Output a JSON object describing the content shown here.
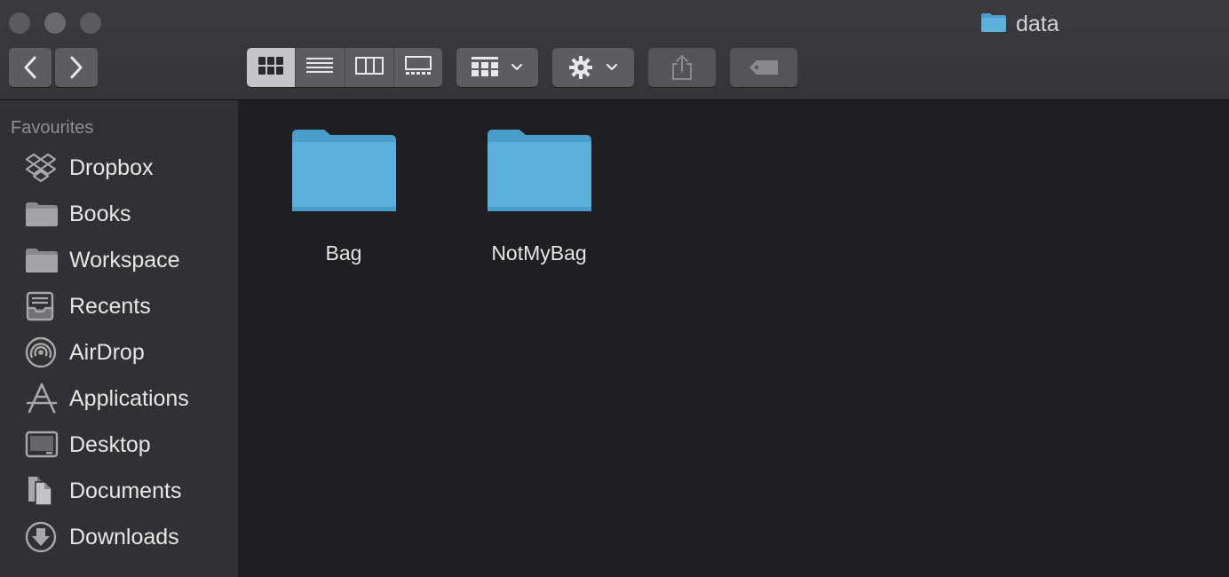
{
  "window": {
    "title": "data"
  },
  "toolbar": {
    "back_icon": "chevron-left-icon",
    "forward_icon": "chevron-right-icon",
    "view_modes": [
      "icon-view",
      "list-view",
      "column-view",
      "gallery-view"
    ],
    "active_view": "icon-view",
    "arrange_icon": "arrange-grid-icon",
    "action_icon": "gear-icon",
    "share_icon": "share-icon",
    "tag_icon": "tag-icon"
  },
  "sidebar": {
    "heading": "Favourites",
    "items": [
      {
        "label": "Dropbox",
        "icon": "dropbox-icon"
      },
      {
        "label": "Books",
        "icon": "folder-icon"
      },
      {
        "label": "Workspace",
        "icon": "folder-icon"
      },
      {
        "label": "Recents",
        "icon": "recents-icon"
      },
      {
        "label": "AirDrop",
        "icon": "airdrop-icon"
      },
      {
        "label": "Applications",
        "icon": "applications-icon"
      },
      {
        "label": "Desktop",
        "icon": "desktop-icon"
      },
      {
        "label": "Documents",
        "icon": "documents-icon"
      },
      {
        "label": "Downloads",
        "icon": "downloads-icon"
      }
    ]
  },
  "content": {
    "items": [
      {
        "name": "Bag",
        "kind": "folder"
      },
      {
        "name": "NotMyBag",
        "kind": "folder"
      }
    ]
  },
  "colors": {
    "folder_blue": "#5bb0dc",
    "folder_tab": "#4a9ccb"
  }
}
